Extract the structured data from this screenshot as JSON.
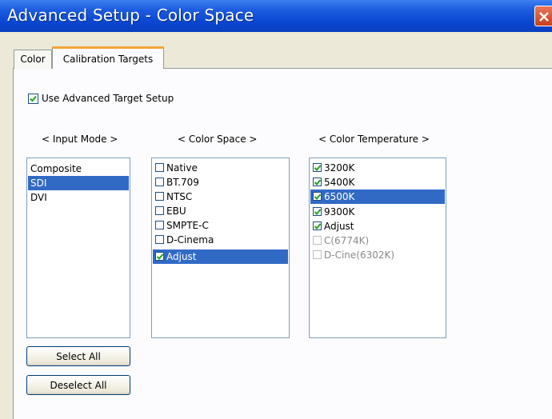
{
  "window": {
    "title": "Advanced Setup - Color Space"
  },
  "tabs": [
    {
      "label": "Color",
      "active": false
    },
    {
      "label": "Calibration Targets",
      "active": true
    }
  ],
  "advanced": {
    "label": "Use Advanced Target Setup",
    "checked": true
  },
  "headers": {
    "input_mode": "< Input Mode >",
    "color_space": "< Color Space >",
    "color_temperature": "< Color Temperature >"
  },
  "input_mode": {
    "items": [
      {
        "label": "Composite",
        "selected": false
      },
      {
        "label": "SDI",
        "selected": true
      },
      {
        "label": "DVI",
        "selected": false
      }
    ]
  },
  "color_space": {
    "items": [
      {
        "label": "Native",
        "checked": false,
        "selected": false,
        "enabled": true
      },
      {
        "label": "BT.709",
        "checked": false,
        "selected": false,
        "enabled": true
      },
      {
        "label": "NTSC",
        "checked": false,
        "selected": false,
        "enabled": true
      },
      {
        "label": "EBU",
        "checked": false,
        "selected": false,
        "enabled": true
      },
      {
        "label": "SMPTE-C",
        "checked": false,
        "selected": false,
        "enabled": true
      },
      {
        "label": "D-Cinema",
        "checked": false,
        "selected": false,
        "enabled": true
      },
      {
        "label": "Adjust",
        "checked": true,
        "selected": true,
        "enabled": true
      }
    ]
  },
  "color_temperature": {
    "items": [
      {
        "label": "3200K",
        "checked": true,
        "selected": false,
        "enabled": true
      },
      {
        "label": "5400K",
        "checked": true,
        "selected": false,
        "enabled": true
      },
      {
        "label": "6500K",
        "checked": true,
        "selected": true,
        "enabled": true
      },
      {
        "label": "9300K",
        "checked": true,
        "selected": false,
        "enabled": true
      },
      {
        "label": "Adjust",
        "checked": true,
        "selected": false,
        "enabled": true
      },
      {
        "label": "C(6774K)",
        "checked": false,
        "selected": false,
        "enabled": false
      },
      {
        "label": "D-Cine(6302K)",
        "checked": false,
        "selected": false,
        "enabled": false
      }
    ]
  },
  "buttons": {
    "select_all": "Select All",
    "deselect_all": "Deselect All"
  },
  "icons": {
    "close": "close-icon",
    "check": "check-icon"
  },
  "colors": {
    "title_bar": "#0a46d1",
    "selection": "#316ac5",
    "check": "#21a121",
    "tab_accent": "#f3a537"
  }
}
